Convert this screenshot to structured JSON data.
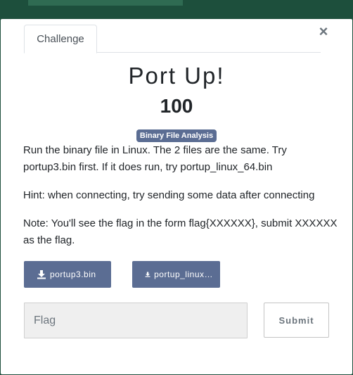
{
  "modal": {
    "tab_label": "Challenge",
    "close_glyph": "×",
    "title": "Port Up!",
    "value": "100",
    "category_badge": "Binary File Analysis",
    "description": [
      "Run the binary file in Linux. The 2 files are the same. Try portup3.bin first. If it does run, try portup_linux_64.bin",
      "Hint: when connecting, try sending some data after connecting",
      "Note: You'll see the flag in the form flag{XXXXXX}, submit XXXXXX as the flag."
    ],
    "files": [
      {
        "label": "portup3.bin",
        "icon": "download-icon"
      },
      {
        "label": "portup_linux…",
        "icon": "download-icon"
      }
    ],
    "flag_input": {
      "placeholder": "Flag",
      "value": ""
    },
    "submit_label": "Submit"
  },
  "colors": {
    "badge": "#5b6d93",
    "file_button": "#5b6d93",
    "backdrop": "#1d4f3c"
  }
}
